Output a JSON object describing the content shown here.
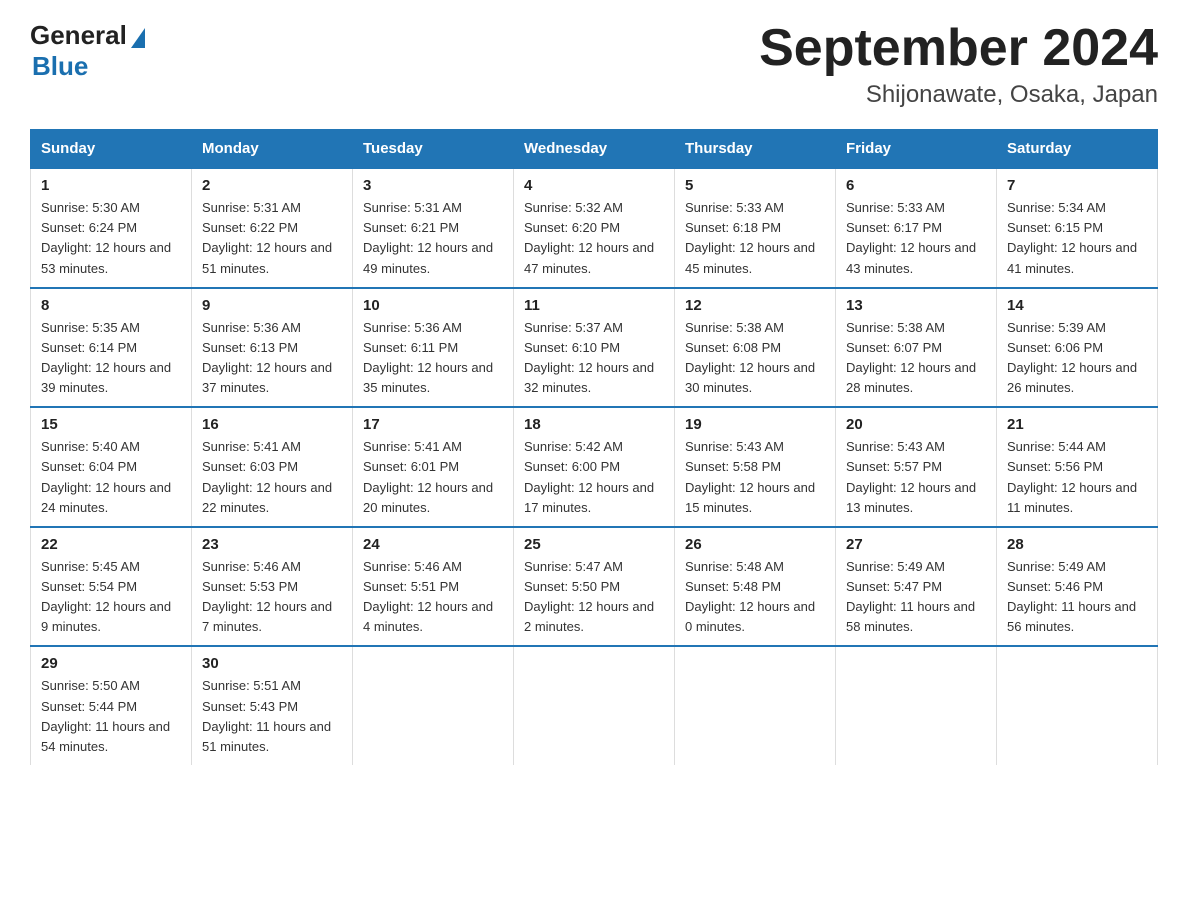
{
  "logo": {
    "general": "General",
    "blue": "Blue"
  },
  "title": "September 2024",
  "location": "Shijonawate, Osaka, Japan",
  "days_of_week": [
    "Sunday",
    "Monday",
    "Tuesday",
    "Wednesday",
    "Thursday",
    "Friday",
    "Saturday"
  ],
  "weeks": [
    [
      {
        "day": "1",
        "sunrise": "5:30 AM",
        "sunset": "6:24 PM",
        "daylight": "12 hours and 53 minutes."
      },
      {
        "day": "2",
        "sunrise": "5:31 AM",
        "sunset": "6:22 PM",
        "daylight": "12 hours and 51 minutes."
      },
      {
        "day": "3",
        "sunrise": "5:31 AM",
        "sunset": "6:21 PM",
        "daylight": "12 hours and 49 minutes."
      },
      {
        "day": "4",
        "sunrise": "5:32 AM",
        "sunset": "6:20 PM",
        "daylight": "12 hours and 47 minutes."
      },
      {
        "day": "5",
        "sunrise": "5:33 AM",
        "sunset": "6:18 PM",
        "daylight": "12 hours and 45 minutes."
      },
      {
        "day": "6",
        "sunrise": "5:33 AM",
        "sunset": "6:17 PM",
        "daylight": "12 hours and 43 minutes."
      },
      {
        "day": "7",
        "sunrise": "5:34 AM",
        "sunset": "6:15 PM",
        "daylight": "12 hours and 41 minutes."
      }
    ],
    [
      {
        "day": "8",
        "sunrise": "5:35 AM",
        "sunset": "6:14 PM",
        "daylight": "12 hours and 39 minutes."
      },
      {
        "day": "9",
        "sunrise": "5:36 AM",
        "sunset": "6:13 PM",
        "daylight": "12 hours and 37 minutes."
      },
      {
        "day": "10",
        "sunrise": "5:36 AM",
        "sunset": "6:11 PM",
        "daylight": "12 hours and 35 minutes."
      },
      {
        "day": "11",
        "sunrise": "5:37 AM",
        "sunset": "6:10 PM",
        "daylight": "12 hours and 32 minutes."
      },
      {
        "day": "12",
        "sunrise": "5:38 AM",
        "sunset": "6:08 PM",
        "daylight": "12 hours and 30 minutes."
      },
      {
        "day": "13",
        "sunrise": "5:38 AM",
        "sunset": "6:07 PM",
        "daylight": "12 hours and 28 minutes."
      },
      {
        "day": "14",
        "sunrise": "5:39 AM",
        "sunset": "6:06 PM",
        "daylight": "12 hours and 26 minutes."
      }
    ],
    [
      {
        "day": "15",
        "sunrise": "5:40 AM",
        "sunset": "6:04 PM",
        "daylight": "12 hours and 24 minutes."
      },
      {
        "day": "16",
        "sunrise": "5:41 AM",
        "sunset": "6:03 PM",
        "daylight": "12 hours and 22 minutes."
      },
      {
        "day": "17",
        "sunrise": "5:41 AM",
        "sunset": "6:01 PM",
        "daylight": "12 hours and 20 minutes."
      },
      {
        "day": "18",
        "sunrise": "5:42 AM",
        "sunset": "6:00 PM",
        "daylight": "12 hours and 17 minutes."
      },
      {
        "day": "19",
        "sunrise": "5:43 AM",
        "sunset": "5:58 PM",
        "daylight": "12 hours and 15 minutes."
      },
      {
        "day": "20",
        "sunrise": "5:43 AM",
        "sunset": "5:57 PM",
        "daylight": "12 hours and 13 minutes."
      },
      {
        "day": "21",
        "sunrise": "5:44 AM",
        "sunset": "5:56 PM",
        "daylight": "12 hours and 11 minutes."
      }
    ],
    [
      {
        "day": "22",
        "sunrise": "5:45 AM",
        "sunset": "5:54 PM",
        "daylight": "12 hours and 9 minutes."
      },
      {
        "day": "23",
        "sunrise": "5:46 AM",
        "sunset": "5:53 PM",
        "daylight": "12 hours and 7 minutes."
      },
      {
        "day": "24",
        "sunrise": "5:46 AM",
        "sunset": "5:51 PM",
        "daylight": "12 hours and 4 minutes."
      },
      {
        "day": "25",
        "sunrise": "5:47 AM",
        "sunset": "5:50 PM",
        "daylight": "12 hours and 2 minutes."
      },
      {
        "day": "26",
        "sunrise": "5:48 AM",
        "sunset": "5:48 PM",
        "daylight": "12 hours and 0 minutes."
      },
      {
        "day": "27",
        "sunrise": "5:49 AM",
        "sunset": "5:47 PM",
        "daylight": "11 hours and 58 minutes."
      },
      {
        "day": "28",
        "sunrise": "5:49 AM",
        "sunset": "5:46 PM",
        "daylight": "11 hours and 56 minutes."
      }
    ],
    [
      {
        "day": "29",
        "sunrise": "5:50 AM",
        "sunset": "5:44 PM",
        "daylight": "11 hours and 54 minutes."
      },
      {
        "day": "30",
        "sunrise": "5:51 AM",
        "sunset": "5:43 PM",
        "daylight": "11 hours and 51 minutes."
      },
      null,
      null,
      null,
      null,
      null
    ]
  ]
}
